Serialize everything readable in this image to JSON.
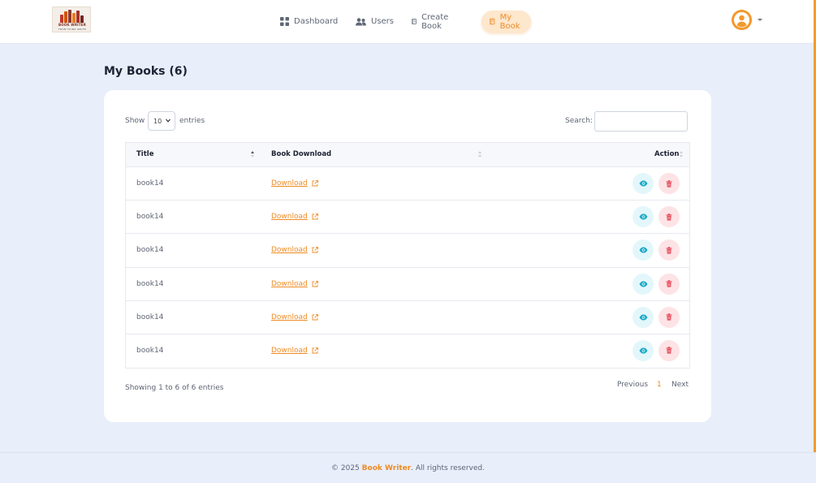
{
  "logo": {
    "brand": "BOOK WRITER",
    "tagline": "FROM THINK WRITE"
  },
  "nav": [
    {
      "label": "Dashboard",
      "icon": "grid-icon",
      "active": false
    },
    {
      "label": "Users",
      "icon": "users-icon",
      "active": false
    },
    {
      "label": "Create Book",
      "icon": "book-icon",
      "active": false
    },
    {
      "label": "My Book",
      "icon": "book-icon",
      "active": true
    }
  ],
  "page": {
    "title": "My Books (6)"
  },
  "length_menu": {
    "show": "Show",
    "value": "10",
    "entries": "entries"
  },
  "search": {
    "label": "Search:",
    "value": ""
  },
  "table": {
    "headers": [
      "Title",
      "Book Download",
      "Action"
    ],
    "rows": [
      {
        "title": "book14",
        "download": "Download"
      },
      {
        "title": "book14",
        "download": "Download"
      },
      {
        "title": "book14",
        "download": "Download"
      },
      {
        "title": "book14",
        "download": "Download"
      },
      {
        "title": "book14",
        "download": "Download"
      },
      {
        "title": "book14",
        "download": "Download"
      }
    ]
  },
  "info": "Showing 1 to 6 of 6 entries",
  "pagination": {
    "previous": "Previous",
    "current": "1",
    "next": "Next"
  },
  "footer": {
    "prefix": "© 2025 ",
    "brand": "Book Writer",
    "suffix": ". All rights reserved."
  },
  "colors": {
    "accent": "#ee8b23",
    "view": "#1aa9c9",
    "delete": "#e5495a",
    "background": "#e8eefa"
  }
}
